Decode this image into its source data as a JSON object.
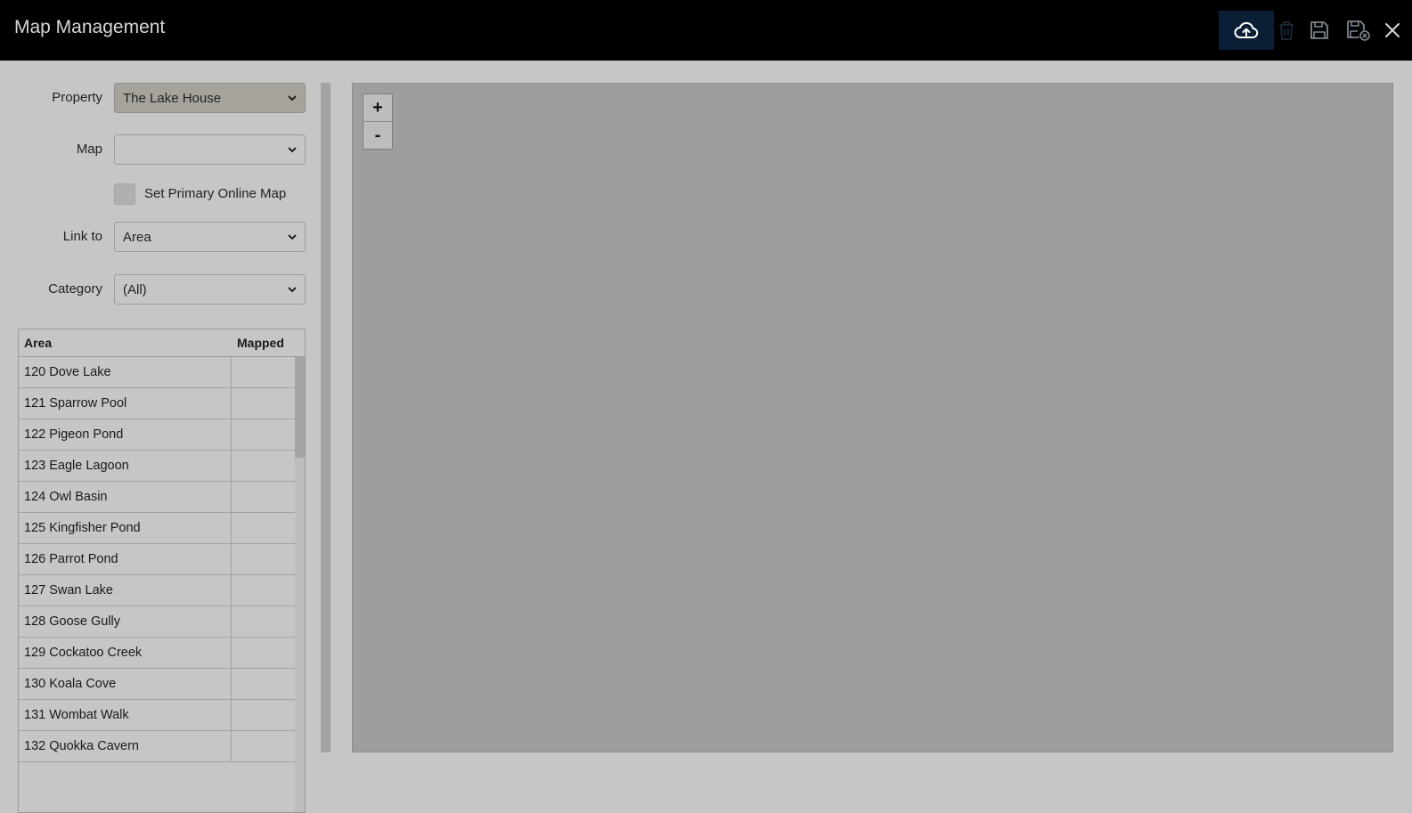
{
  "header": {
    "title": "Map Management",
    "accent_color": "#0a1e36",
    "icons": [
      "cloud-upload-icon",
      "trash-icon",
      "save-icon",
      "save-close-icon",
      "close-icon"
    ]
  },
  "form": {
    "property": {
      "label": "Property",
      "value": "The Lake House"
    },
    "map": {
      "label": "Map",
      "value": ""
    },
    "primary_online_map": {
      "label": "Set Primary Online Map",
      "checked": false
    },
    "link_to": {
      "label": "Link to",
      "value": "Area"
    },
    "category": {
      "label": "Category",
      "value": "(All)"
    }
  },
  "table": {
    "headers": [
      "Area",
      "Mapped"
    ],
    "rows": [
      {
        "area": "120 Dove Lake",
        "mapped": ""
      },
      {
        "area": "121 Sparrow Pool",
        "mapped": ""
      },
      {
        "area": "122 Pigeon Pond",
        "mapped": ""
      },
      {
        "area": "123 Eagle Lagoon",
        "mapped": ""
      },
      {
        "area": "124 Owl Basin",
        "mapped": ""
      },
      {
        "area": "125 Kingfisher Pond",
        "mapped": ""
      },
      {
        "area": "126 Parrot Pond",
        "mapped": ""
      },
      {
        "area": "127 Swan Lake",
        "mapped": ""
      },
      {
        "area": "128 Goose Gully",
        "mapped": ""
      },
      {
        "area": "129 Cockatoo Creek",
        "mapped": ""
      },
      {
        "area": "130 Koala Cove",
        "mapped": ""
      },
      {
        "area": "131 Wombat Walk",
        "mapped": ""
      },
      {
        "area": "132 Quokka Cavern",
        "mapped": ""
      }
    ]
  },
  "map_view": {
    "zoom_in": "+",
    "zoom_out": "-"
  }
}
